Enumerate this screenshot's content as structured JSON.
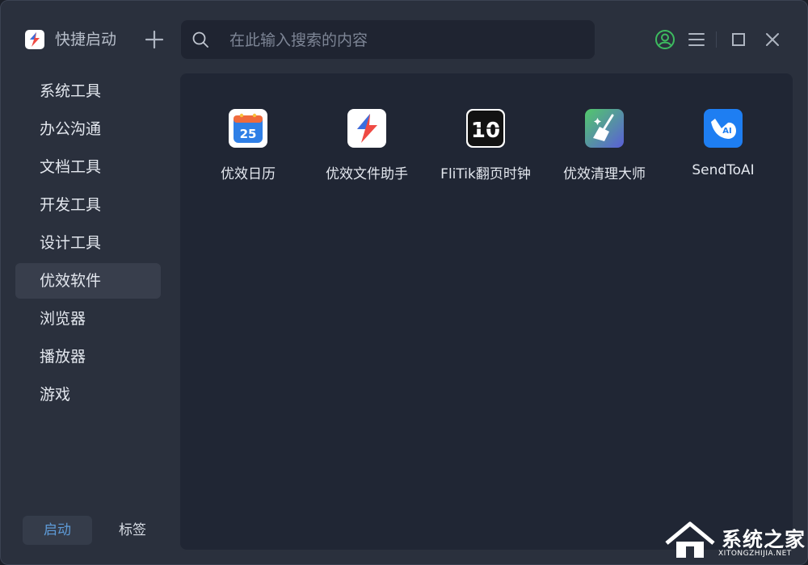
{
  "header": {
    "app_title": "快捷启动",
    "search_placeholder": "在此输入搜索的内容",
    "accent_color": "#3dbb5f"
  },
  "sidebar": {
    "items": [
      {
        "label": "系统工具",
        "active": false
      },
      {
        "label": "办公沟通",
        "active": false
      },
      {
        "label": "文档工具",
        "active": false
      },
      {
        "label": "开发工具",
        "active": false
      },
      {
        "label": "设计工具",
        "active": false
      },
      {
        "label": "优效软件",
        "active": true
      },
      {
        "label": "浏览器",
        "active": false
      },
      {
        "label": "播放器",
        "active": false
      },
      {
        "label": "游戏",
        "active": false
      }
    ],
    "bottom_tabs": [
      {
        "label": "启动",
        "active": true,
        "color": "#5e9bd8"
      },
      {
        "label": "标签",
        "active": false
      }
    ]
  },
  "main": {
    "apps": [
      {
        "name": "优效日历",
        "icon": "calendar-icon",
        "icon_text": "25"
      },
      {
        "name": "优效文件助手",
        "icon": "file-assistant-icon"
      },
      {
        "name": "FliTik翻页时钟",
        "icon": "flip-clock-icon",
        "icon_text": "10"
      },
      {
        "name": "优效清理大师",
        "icon": "cleaner-icon"
      },
      {
        "name": "SendToAI",
        "icon": "send-to-ai-icon",
        "icon_text": "AI"
      }
    ]
  },
  "watermark": {
    "text": "系统之家",
    "url_text": "XITONGZHIJIA.NET"
  }
}
